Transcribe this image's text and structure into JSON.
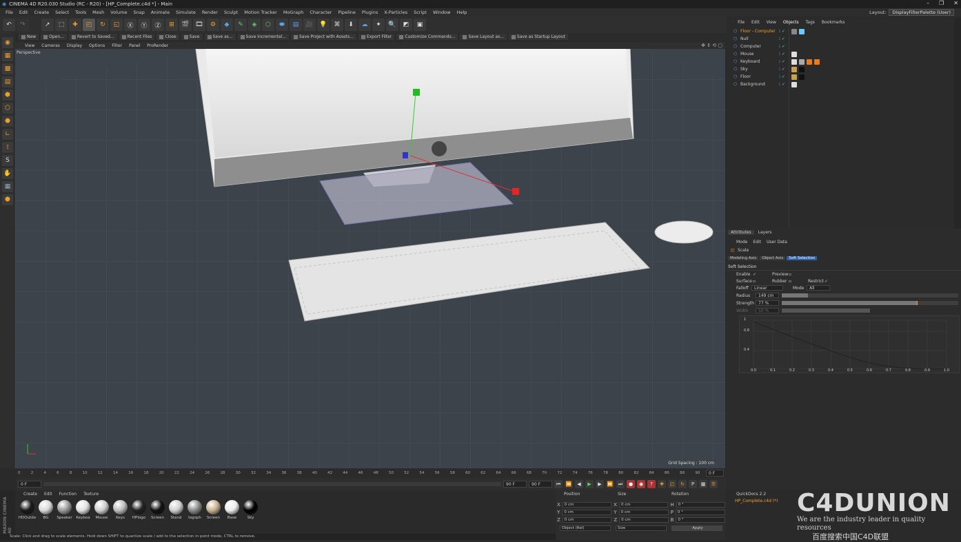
{
  "window": {
    "title": "CINEMA 4D R20.030 Studio (RC - R20) - [HP_Complete.c4d *] - Main",
    "min": "–",
    "max": "❐",
    "close": "✕"
  },
  "menubar": {
    "items": [
      "File",
      "Edit",
      "Create",
      "Select",
      "Tools",
      "Mesh",
      "Volume",
      "Snap",
      "Animate",
      "Simulate",
      "Render",
      "Sculpt",
      "Motion Tracker",
      "MoGraph",
      "Character",
      "Pipeline",
      "Plugins",
      "X-Particles",
      "Script",
      "Window",
      "Help"
    ],
    "layout_label": "Layout:",
    "layout_value": "DisplayFilterPalette (User)"
  },
  "cmdbar": {
    "items": [
      "New",
      "Open...",
      "Revert to Saved...",
      "Recent Files",
      "Close",
      "Save",
      "Save as...",
      "Save Incremental...",
      "Save Project with Assets...",
      "Export Filter",
      "Customize Commands...",
      "Save Layout as...",
      "Save as Startup Layout"
    ]
  },
  "viewport": {
    "menu": [
      "View",
      "Cameras",
      "Display",
      "Options",
      "Filter",
      "Panel",
      "ProRender"
    ],
    "label": "Perspective",
    "grid_spacing": "Grid Spacing : 100 cm"
  },
  "timeline": {
    "ticks": [
      "0",
      "2",
      "4",
      "6",
      "8",
      "10",
      "12",
      "14",
      "16",
      "18",
      "20",
      "22",
      "24",
      "26",
      "28",
      "30",
      "32",
      "34",
      "36",
      "38",
      "40",
      "42",
      "44",
      "46",
      "48",
      "50",
      "52",
      "54",
      "56",
      "58",
      "60",
      "62",
      "64",
      "66",
      "68",
      "70",
      "72",
      "74",
      "76",
      "78",
      "80",
      "82",
      "84",
      "86",
      "88",
      "90"
    ],
    "current_frame": "0 F",
    "start": "0 F",
    "end": "90 F",
    "end2": "90 F"
  },
  "materials": {
    "menu": [
      "Create",
      "Edit",
      "Function",
      "Texture"
    ],
    "items": [
      {
        "name": "HDOutdo",
        "color": "#1a1a1a"
      },
      {
        "name": "BG",
        "color": "#d9d9d9"
      },
      {
        "name": "Speaker",
        "color": "#9a9a9a"
      },
      {
        "name": "Keyboa",
        "color": "#e0e0e0"
      },
      {
        "name": "Mouse",
        "color": "#cfcfcf"
      },
      {
        "name": "Keys",
        "color": "#bdbdbd"
      },
      {
        "name": "HPlogo",
        "color": "#222"
      },
      {
        "name": "Screen",
        "color": "#111"
      },
      {
        "name": "Stand",
        "color": "#cfcfcf"
      },
      {
        "name": "logoph",
        "color": "#8a8a8a"
      },
      {
        "name": "Screen",
        "color": "#c8b090"
      },
      {
        "name": "Base",
        "color": "#ececec"
      },
      {
        "name": "Sky",
        "color": "#000"
      }
    ]
  },
  "coords": {
    "headers": [
      "Position",
      "Size",
      "Rotation"
    ],
    "rows": [
      {
        "a": "X",
        "pos": "0 cm",
        "b": "X",
        "size": "0 cm",
        "c": "H",
        "rot": "0 °"
      },
      {
        "a": "Y",
        "pos": "0 cm",
        "b": "Y",
        "size": "0 cm",
        "c": "P",
        "rot": "0 °"
      },
      {
        "a": "Z",
        "pos": "0 cm",
        "b": "Z",
        "size": "0 cm",
        "c": "B",
        "rot": "0 °"
      }
    ],
    "mode": "Object (Rel)",
    "size_mode": "Size",
    "apply": "Apply"
  },
  "objects": {
    "menu": [
      "File",
      "Edit",
      "View",
      "Objects",
      "Tags",
      "Bookmarks"
    ],
    "items": [
      {
        "name": "Floor - Computer",
        "color": "#f0a030",
        "tags": [
          "#888",
          "#6cf"
        ]
      },
      {
        "name": "Null",
        "color": "#ccc",
        "tags": []
      },
      {
        "name": "Computer",
        "color": "#ccc",
        "tags": []
      },
      {
        "name": "Mouse",
        "color": "#ccc",
        "tags": [
          "#ddd"
        ]
      },
      {
        "name": "Keyboard",
        "color": "#ccc",
        "tags": [
          "#ddd",
          "#aaa",
          "#e87a20",
          "#e87a20"
        ]
      },
      {
        "name": "Sky",
        "color": "#ccc",
        "tags": [
          "#c8a050",
          "#111"
        ]
      },
      {
        "name": "Floor",
        "color": "#ccc",
        "tags": [
          "#c8a050",
          "#111"
        ]
      },
      {
        "name": "Background",
        "color": "#ccc",
        "tags": [
          "#ddd"
        ]
      }
    ]
  },
  "attributes": {
    "tabs": [
      "Attributes",
      "Layers"
    ],
    "menu": [
      "Mode",
      "Edit",
      "User Data"
    ],
    "tool": "Scale",
    "subtabs": [
      "Modeling Axis",
      "Object Axis",
      "Soft Selection"
    ],
    "section": "Soft Selection",
    "enable": "Enable",
    "preview": "Preview",
    "surface": "Surface",
    "rubber": "Rubber",
    "restrict": "Restrict",
    "falloff_label": "Falloff",
    "falloff_value": "Linear",
    "mode_label": "Mode",
    "mode_value": "All",
    "radius_label": "Radius",
    "radius_value": "149 cm",
    "strength_label": "Strength",
    "strength_value": "77 %",
    "width_label": "Width",
    "width_value": "50 %",
    "graph_y": [
      "1",
      "0.8",
      "0.4"
    ],
    "graph_x": [
      "0.0",
      "0.1",
      "0.2",
      "0.3",
      "0.4",
      "0.5",
      "0.6",
      "0.7",
      "0.8",
      "0.9",
      "1.0"
    ]
  },
  "quickdocs": {
    "title": "QuickDocs 2.2",
    "file": "HP_Complete.c4d (*)"
  },
  "watermark": {
    "title": "C4DUNION",
    "tagline": "We are the industry leader in quality resources",
    "search": "百度搜索中国C4D联盟"
  },
  "status": "Scale: Click and drag to scale elements. Hold down SHIFT to quantize scale / add to the selection in point mode, CTRL to remove.",
  "maxon": "MAXON CINEMA 4D"
}
